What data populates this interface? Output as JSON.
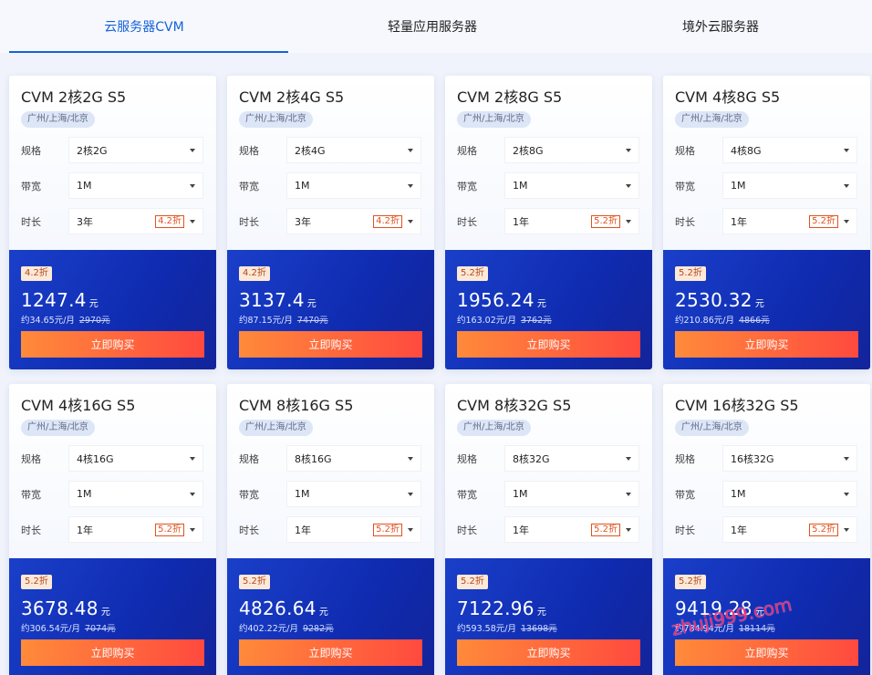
{
  "tabs": [
    {
      "label": "云服务器CVM",
      "active": true
    },
    {
      "label": "轻量应用服务器",
      "active": false
    },
    {
      "label": "境外云服务器",
      "active": false
    }
  ],
  "labels": {
    "spec": "规格",
    "bandwidth": "带宽",
    "duration": "时长",
    "buy": "立即购买",
    "yuan": "元"
  },
  "cards": [
    {
      "title": "CVM 2核2G S5",
      "region": "广州/上海/北京",
      "spec": "2核2G",
      "bandwidth": "1M",
      "duration": "3年",
      "discount": "4.2折",
      "price": "1247.4",
      "monthly": "约34.65元/月",
      "original": "2970元"
    },
    {
      "title": "CVM 2核4G S5",
      "region": "广州/上海/北京",
      "spec": "2核4G",
      "bandwidth": "1M",
      "duration": "3年",
      "discount": "4.2折",
      "price": "3137.4",
      "monthly": "约87.15元/月",
      "original": "7470元"
    },
    {
      "title": "CVM 2核8G S5",
      "region": "广州/上海/北京",
      "spec": "2核8G",
      "bandwidth": "1M",
      "duration": "1年",
      "discount": "5.2折",
      "price": "1956.24",
      "monthly": "约163.02元/月",
      "original": "3762元"
    },
    {
      "title": "CVM 4核8G S5",
      "region": "广州/上海/北京",
      "spec": "4核8G",
      "bandwidth": "1M",
      "duration": "1年",
      "discount": "5.2折",
      "price": "2530.32",
      "monthly": "约210.86元/月",
      "original": "4866元"
    },
    {
      "title": "CVM 4核16G S5",
      "region": "广州/上海/北京",
      "spec": "4核16G",
      "bandwidth": "1M",
      "duration": "1年",
      "discount": "5.2折",
      "price": "3678.48",
      "monthly": "约306.54元/月",
      "original": "7074元"
    },
    {
      "title": "CVM 8核16G S5",
      "region": "广州/上海/北京",
      "spec": "8核16G",
      "bandwidth": "1M",
      "duration": "1年",
      "discount": "5.2折",
      "price": "4826.64",
      "monthly": "约402.22元/月",
      "original": "9282元"
    },
    {
      "title": "CVM 8核32G S5",
      "region": "广州/上海/北京",
      "spec": "8核32G",
      "bandwidth": "1M",
      "duration": "1年",
      "discount": "5.2折",
      "price": "7122.96",
      "monthly": "约593.58元/月",
      "original": "13698元"
    },
    {
      "title": "CVM 16核32G S5",
      "region": "广州/上海/北京",
      "spec": "16核32G",
      "bandwidth": "1M",
      "duration": "1年",
      "discount": "5.2折",
      "price": "9419.28",
      "monthly": "约784.94元/月",
      "original": "18114元"
    }
  ],
  "watermark": "zhuji999.com",
  "colors": {
    "accent": "#1662d8",
    "price_panel": "#1a3fc9",
    "buy_button_start": "#ff8a3a",
    "buy_button_end": "#ff4a3f",
    "discount_tag": "#e0531f"
  }
}
